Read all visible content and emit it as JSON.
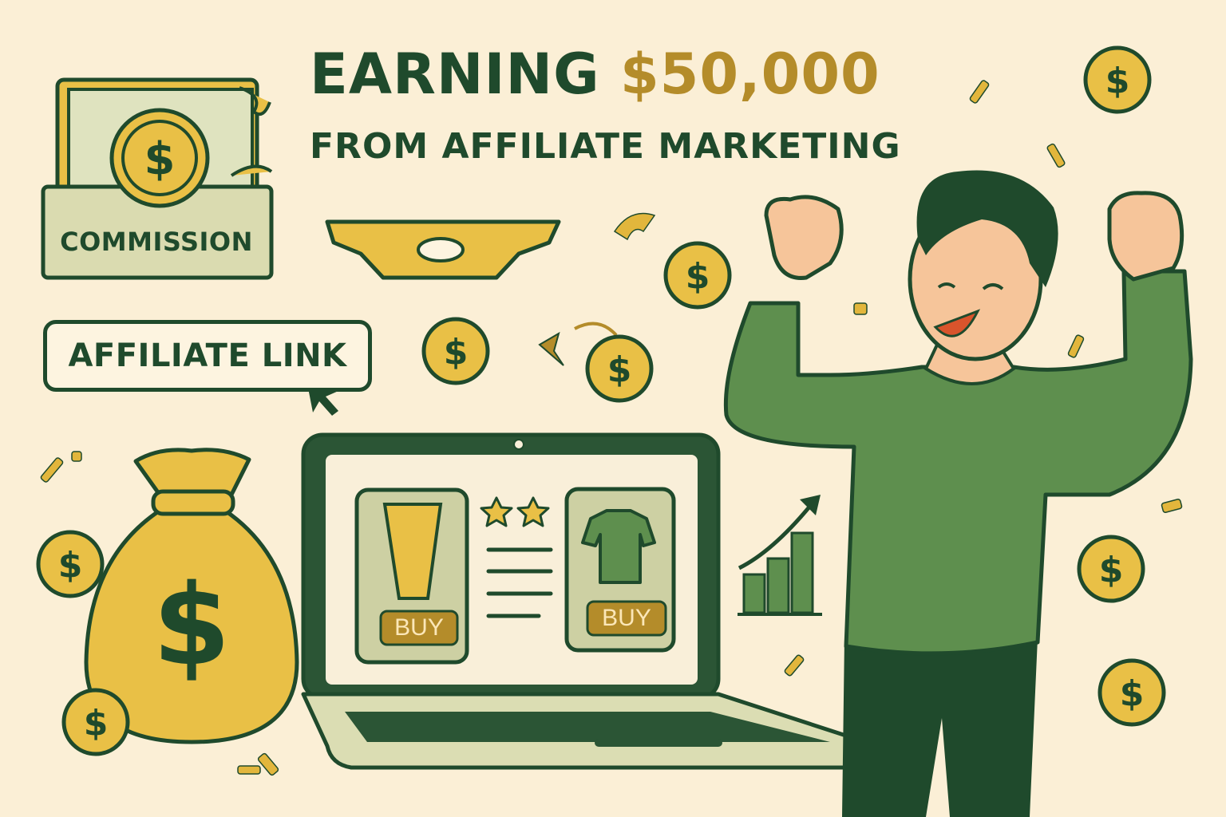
{
  "title": {
    "line1_prefix": "EARNING",
    "line1_amount": "$50,000",
    "line2": "FROM AFFILIATE MARKETING"
  },
  "labels": {
    "commission": "COMMISSION",
    "affiliate_link": "AFFILIATE LINK",
    "buy_left": "BUY",
    "buy_right": "BUY",
    "coin_symbol": "$"
  },
  "colors": {
    "background": "#fbefd6",
    "dark_green": "#1f4a2c",
    "gold": "#e9c046",
    "dark_gold": "#b48c2a",
    "shirt_green": "#5e8f4e"
  }
}
